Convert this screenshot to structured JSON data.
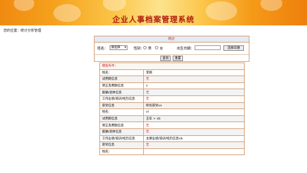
{
  "app": {
    "title": "企业人事档案管理系统"
  },
  "location": {
    "text": "您的位置：统计分析管理"
  },
  "search": {
    "header": "统计",
    "name_label": "姓名：",
    "name_select": "请选择",
    "gender_label": "性别：",
    "male": "男",
    "female": "女",
    "birthdate_label": "出生日期：",
    "birthdate_value": "",
    "date_button": "选择日期",
    "query_button": "查询",
    "reset_button": "重置"
  },
  "results": {
    "header": "模板条件：",
    "rows": [
      {
        "label": "姓名：",
        "value": "李刚",
        "red": false
      },
      {
        "label": "试用期信息",
        "value": "无",
        "red": true
      },
      {
        "label": "转正及聘期信息",
        "value": "v",
        "red": false
      },
      {
        "label": "薪酬/退休信息",
        "value": "无",
        "red": true
      },
      {
        "label": "工作业绩/培训/经历信息",
        "value": "无",
        "red": true
      },
      {
        "label": "获奖信息",
        "value": "所有获奖vv",
        "red": false
      },
      {
        "label": "姓名：",
        "value": "vl",
        "red": false
      },
      {
        "label": "试用期信息",
        "value": "王军 > vb",
        "red": false
      },
      {
        "label": "转正及聘期信息",
        "value": "无",
        "red": true
      },
      {
        "label": "薪酬/退休信息",
        "value": "无",
        "red": true
      },
      {
        "label": "工作业绩/培训/经历信息",
        "value": "主要业绩/培训/经历信息vb",
        "red": false
      },
      {
        "label": "获奖信息",
        "value": "无",
        "red": true
      },
      {
        "label": "姓名：",
        "value": "",
        "red": false
      }
    ]
  },
  "colors": {
    "title_red": "#b01d0d",
    "accent_red": "#d02020",
    "border": "#d6a27a",
    "header_blue": "#e2eaf6"
  }
}
